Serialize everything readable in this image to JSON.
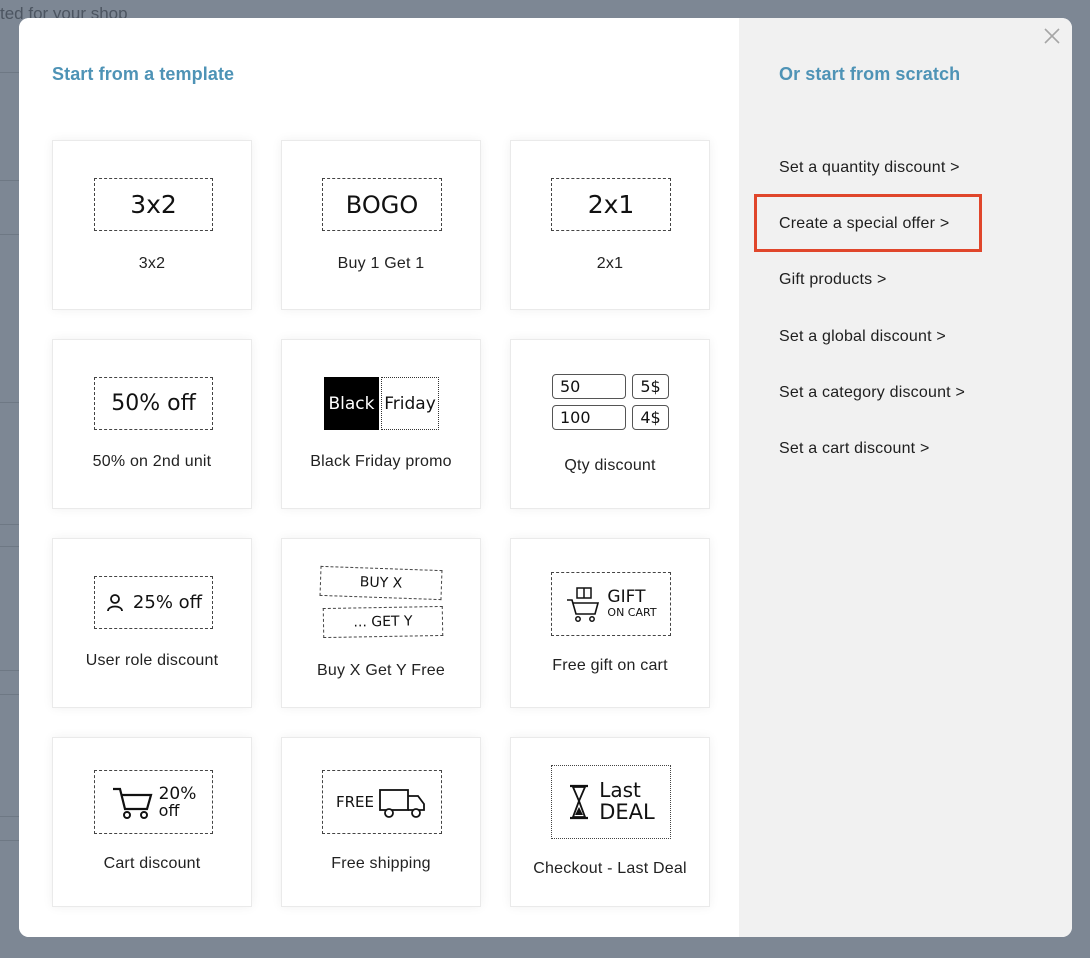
{
  "background": {
    "partial_text": "ted for your shop"
  },
  "modal": {
    "left_heading": "Start from a template",
    "right_heading": "Or start from scratch",
    "close_symbol": "×"
  },
  "templates": [
    {
      "label": "3x2",
      "badge": "3x2"
    },
    {
      "label": "Buy 1 Get 1",
      "badge": "BOGO"
    },
    {
      "label": "2x1",
      "badge": "2x1"
    },
    {
      "label": "50% on 2nd unit",
      "badge": "50% off"
    },
    {
      "label": "Black Friday promo",
      "badge_left": "Black",
      "badge_right": "Friday"
    },
    {
      "label": "Qty discount",
      "rows": [
        {
          "qty": "50",
          "price": "5$"
        },
        {
          "qty": "100",
          "price": "4$"
        }
      ]
    },
    {
      "label": "User role discount",
      "badge": "25% off",
      "icon": "user-icon"
    },
    {
      "label": "Buy X Get Y Free",
      "badge_top": "BUY X",
      "badge_bottom": "... GET Y"
    },
    {
      "label": "Free gift on cart",
      "badge_top": "GIFT",
      "badge_bottom": "ON CART",
      "icon": "gift-cart-icon"
    },
    {
      "label": "Cart discount",
      "badge_top": "20%",
      "badge_bottom": "off",
      "icon": "cart-icon"
    },
    {
      "label": "Free shipping",
      "badge": "FREE",
      "icon": "truck-icon"
    },
    {
      "label": "Checkout - Last Deal",
      "badge_top": "Last",
      "badge_bottom": "DEAL",
      "icon": "hourglass-icon"
    }
  ],
  "scratch_options": [
    {
      "label": "Set a quantity discount >"
    },
    {
      "label": "Create a special offer >",
      "highlighted": true
    },
    {
      "label": "Gift products >"
    },
    {
      "label": "Set a global discount >"
    },
    {
      "label": "Set a category discount >"
    },
    {
      "label": "Set a cart discount >"
    }
  ],
  "colors": {
    "heading": "#4e93b6",
    "highlight_border": "#e0462b",
    "right_pane_bg": "#f1f1f1",
    "overlay": "#7d8794"
  }
}
